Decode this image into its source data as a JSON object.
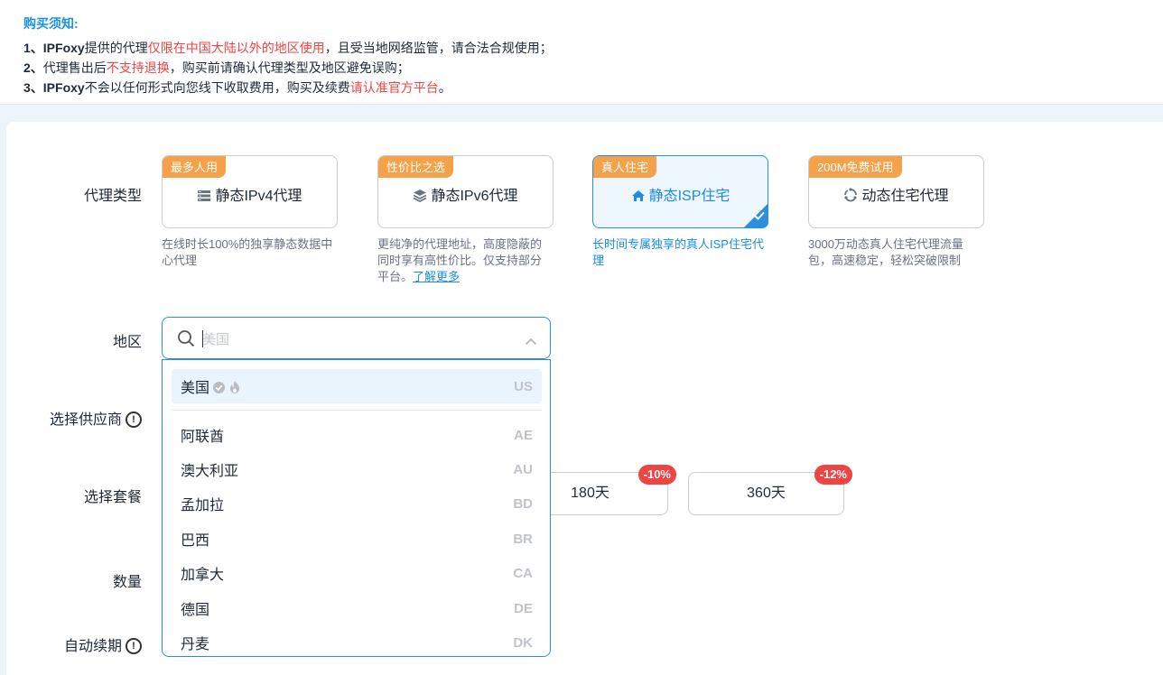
{
  "notice": {
    "title": "购买须知:",
    "lines": [
      {
        "prefix": "1、",
        "brand": "IPFoxy",
        "a": "提供的代理",
        "red": "仅限在中国大陆以外的地区使用",
        "b": "，且受当地网络监管，请合法合规使用；"
      },
      {
        "prefix": "2、",
        "a": "代理售出后",
        "red": "不支持退换",
        "b": "，购买前请确认代理类型及地区避免误购；"
      },
      {
        "prefix": "3、",
        "brand": "IPFoxy",
        "a": "不会以任何形式向您线下收取费用，购买及续费",
        "red": "请认准官方平台",
        "b": "。"
      }
    ]
  },
  "labels": {
    "proxy_type": "代理类型",
    "region": "地区",
    "provider": "选择供应商",
    "plan": "选择套餐",
    "quantity": "数量",
    "auto_renew": "自动续期"
  },
  "proxy_types": [
    {
      "tag": "最多人用",
      "title": "静态IPv4代理",
      "icon": "server-icon",
      "desc": "在线时长100%的独享静态数据中心代理"
    },
    {
      "tag": "性价比之选",
      "title": "静态IPv6代理",
      "icon": "layers-icon",
      "desc": "更纯净的代理地址，高度隐蔽的同时享有高性价比。仅支持部分平台。",
      "link": "了解更多"
    },
    {
      "tag": "真人住宅",
      "title": "静态ISP住宅",
      "icon": "home-icon",
      "desc": "长时间专属独享的真人ISP住宅代理",
      "selected": true
    },
    {
      "tag": "200M免费试用",
      "title": "动态住宅代理",
      "icon": "rotate-icon",
      "desc": "3000万动态真人住宅代理流量包，高速稳定，轻松突破限制"
    }
  ],
  "region": {
    "placeholder": "美国",
    "value": ""
  },
  "region_options": [
    {
      "name": "美国",
      "code": "US",
      "active": true
    },
    {
      "name": "阿联酋",
      "code": "AE"
    },
    {
      "name": "澳大利亚",
      "code": "AU"
    },
    {
      "name": "孟加拉",
      "code": "BD"
    },
    {
      "name": "巴西",
      "code": "BR"
    },
    {
      "name": "加拿大",
      "code": "CA"
    },
    {
      "name": "德国",
      "code": "DE"
    },
    {
      "name": "丹麦",
      "code": "DK"
    }
  ],
  "plans": [
    {
      "label": "180天",
      "discount": "-10%"
    },
    {
      "label": "360天",
      "discount": "-12%"
    }
  ],
  "colors": {
    "accent": "#2a8fe0",
    "tag": "#f4a14a",
    "warning": "#ef4444"
  }
}
